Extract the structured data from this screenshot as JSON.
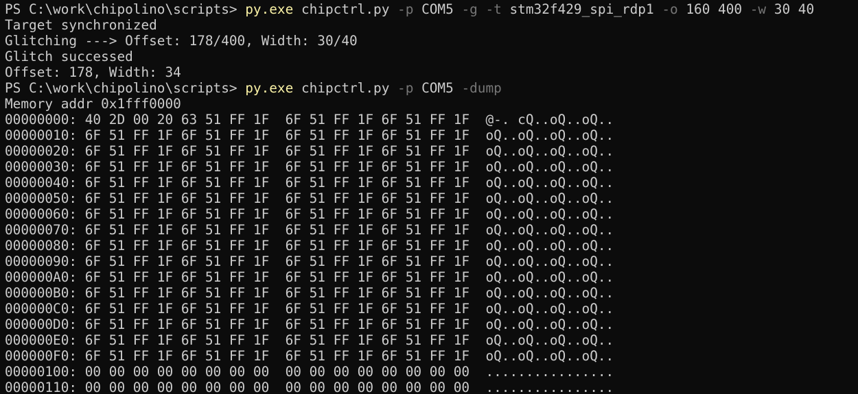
{
  "terminal": {
    "colors": {
      "background": "#0c0c0c",
      "foreground": "#cccccc",
      "command": "#f9f1a5",
      "flag": "#767676"
    },
    "lines": [
      {
        "type": "command",
        "tokens": [
          {
            "t": "PS C:\\work\\chipolino\\scripts> ",
            "c": "plain"
          },
          {
            "t": "py.exe",
            "c": "cmd"
          },
          {
            "t": " chipctrl.py ",
            "c": "plain"
          },
          {
            "t": "-p",
            "c": "flag"
          },
          {
            "t": " COM5 ",
            "c": "plain"
          },
          {
            "t": "-g -t",
            "c": "flag"
          },
          {
            "t": " stm32f429_spi_rdp1 ",
            "c": "plain"
          },
          {
            "t": "-o",
            "c": "flag"
          },
          {
            "t": " 160 400 ",
            "c": "plain"
          },
          {
            "t": "-w",
            "c": "flag"
          },
          {
            "t": " 30 40",
            "c": "plain"
          }
        ]
      },
      {
        "type": "output",
        "text": "Target synchronized"
      },
      {
        "type": "output",
        "text": "Glitching ---> Offset: 178/400, Width: 30/40"
      },
      {
        "type": "output",
        "text": "Glitch successed"
      },
      {
        "type": "output",
        "text": "Offset: 178, Width: 34"
      },
      {
        "type": "command",
        "tokens": [
          {
            "t": "PS C:\\work\\chipolino\\scripts> ",
            "c": "plain"
          },
          {
            "t": "py.exe",
            "c": "cmd"
          },
          {
            "t": " chipctrl.py ",
            "c": "plain"
          },
          {
            "t": "-p",
            "c": "flag"
          },
          {
            "t": " COM5 ",
            "c": "plain"
          },
          {
            "t": "-dump",
            "c": "flag"
          }
        ]
      },
      {
        "type": "output",
        "text": "Memory addr 0x1fff0000"
      },
      {
        "type": "output",
        "text": "00000000: 40 2D 00 20 63 51 FF 1F  6F 51 FF 1F 6F 51 FF 1F  @-. cQ..oQ..oQ.."
      },
      {
        "type": "output",
        "text": "00000010: 6F 51 FF 1F 6F 51 FF 1F  6F 51 FF 1F 6F 51 FF 1F  oQ..oQ..oQ..oQ.."
      },
      {
        "type": "output",
        "text": "00000020: 6F 51 FF 1F 6F 51 FF 1F  6F 51 FF 1F 6F 51 FF 1F  oQ..oQ..oQ..oQ.."
      },
      {
        "type": "output",
        "text": "00000030: 6F 51 FF 1F 6F 51 FF 1F  6F 51 FF 1F 6F 51 FF 1F  oQ..oQ..oQ..oQ.."
      },
      {
        "type": "output",
        "text": "00000040: 6F 51 FF 1F 6F 51 FF 1F  6F 51 FF 1F 6F 51 FF 1F  oQ..oQ..oQ..oQ.."
      },
      {
        "type": "output",
        "text": "00000050: 6F 51 FF 1F 6F 51 FF 1F  6F 51 FF 1F 6F 51 FF 1F  oQ..oQ..oQ..oQ.."
      },
      {
        "type": "output",
        "text": "00000060: 6F 51 FF 1F 6F 51 FF 1F  6F 51 FF 1F 6F 51 FF 1F  oQ..oQ..oQ..oQ.."
      },
      {
        "type": "output",
        "text": "00000070: 6F 51 FF 1F 6F 51 FF 1F  6F 51 FF 1F 6F 51 FF 1F  oQ..oQ..oQ..oQ.."
      },
      {
        "type": "output",
        "text": "00000080: 6F 51 FF 1F 6F 51 FF 1F  6F 51 FF 1F 6F 51 FF 1F  oQ..oQ..oQ..oQ.."
      },
      {
        "type": "output",
        "text": "00000090: 6F 51 FF 1F 6F 51 FF 1F  6F 51 FF 1F 6F 51 FF 1F  oQ..oQ..oQ..oQ.."
      },
      {
        "type": "output",
        "text": "000000A0: 6F 51 FF 1F 6F 51 FF 1F  6F 51 FF 1F 6F 51 FF 1F  oQ..oQ..oQ..oQ.."
      },
      {
        "type": "output",
        "text": "000000B0: 6F 51 FF 1F 6F 51 FF 1F  6F 51 FF 1F 6F 51 FF 1F  oQ..oQ..oQ..oQ.."
      },
      {
        "type": "output",
        "text": "000000C0: 6F 51 FF 1F 6F 51 FF 1F  6F 51 FF 1F 6F 51 FF 1F  oQ..oQ..oQ..oQ.."
      },
      {
        "type": "output",
        "text": "000000D0: 6F 51 FF 1F 6F 51 FF 1F  6F 51 FF 1F 6F 51 FF 1F  oQ..oQ..oQ..oQ.."
      },
      {
        "type": "output",
        "text": "000000E0: 6F 51 FF 1F 6F 51 FF 1F  6F 51 FF 1F 6F 51 FF 1F  oQ..oQ..oQ..oQ.."
      },
      {
        "type": "output",
        "text": "000000F0: 6F 51 FF 1F 6F 51 FF 1F  6F 51 FF 1F 6F 51 FF 1F  oQ..oQ..oQ..oQ.."
      },
      {
        "type": "output",
        "text": "00000100: 00 00 00 00 00 00 00 00  00 00 00 00 00 00 00 00  ................"
      },
      {
        "type": "output",
        "text": "00000110: 00 00 00 00 00 00 00 00  00 00 00 00 00 00 00 00  ................"
      }
    ]
  }
}
